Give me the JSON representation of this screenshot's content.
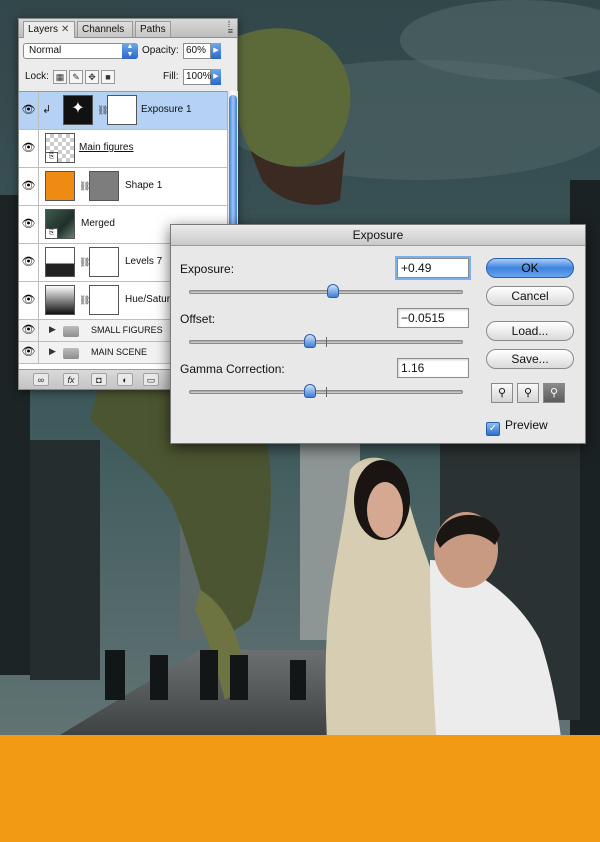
{
  "layers_panel": {
    "tabs": [
      {
        "label": "Layers",
        "active": true,
        "closable": true
      },
      {
        "label": "Channels",
        "active": false
      },
      {
        "label": "Paths",
        "active": false
      }
    ],
    "blend_mode": "Normal",
    "opacity_label": "Opacity:",
    "opacity_value": "60%",
    "lock_label": "Lock:",
    "fill_label": "Fill:",
    "fill_value": "100%",
    "layers": [
      {
        "name": "Exposure 1",
        "visible": true,
        "selected": true,
        "kind": "adjustment"
      },
      {
        "name": "Main figures",
        "visible": true,
        "kind": "smart-object"
      },
      {
        "name": "Shape 1",
        "visible": true,
        "kind": "shape"
      },
      {
        "name": "Merged",
        "visible": true,
        "kind": "smart-object"
      },
      {
        "name": "Levels 7",
        "visible": true,
        "kind": "adjustment"
      },
      {
        "name": "Hue/Satur",
        "visible": true,
        "kind": "adjustment"
      }
    ],
    "groups": [
      {
        "name": "SMALL FIGURES",
        "visible": true,
        "expanded": false
      },
      {
        "name": "MAIN SCENE",
        "visible": true,
        "expanded": false
      }
    ],
    "bottom_buttons": [
      "link-icon",
      "fx-icon",
      "mask-icon",
      "adjustment-icon",
      "folder-icon"
    ],
    "fx_label": "fx"
  },
  "exposure_dialog": {
    "title": "Exposure",
    "controls": [
      {
        "label": "Exposure:",
        "value": "+0.49",
        "slider_fraction": 0.525,
        "focused": true
      },
      {
        "label": "Offset:",
        "value": "−0.0515",
        "slider_fraction": 0.44
      },
      {
        "label": "Gamma Correction:",
        "value": "1.16",
        "slider_fraction": 0.44
      }
    ],
    "buttons": {
      "ok": "OK",
      "cancel": "Cancel",
      "load": "Load...",
      "save": "Save..."
    },
    "eyedroppers": [
      "black-point-eyedropper-icon",
      "gray-point-eyedropper-icon",
      "white-point-eyedropper-icon"
    ],
    "preview_label": "Preview",
    "preview_checked": true
  },
  "colors": {
    "accent_blue": "#3d82de",
    "band_orange": "#f29a14",
    "selected_row": "#b5d2f4"
  }
}
